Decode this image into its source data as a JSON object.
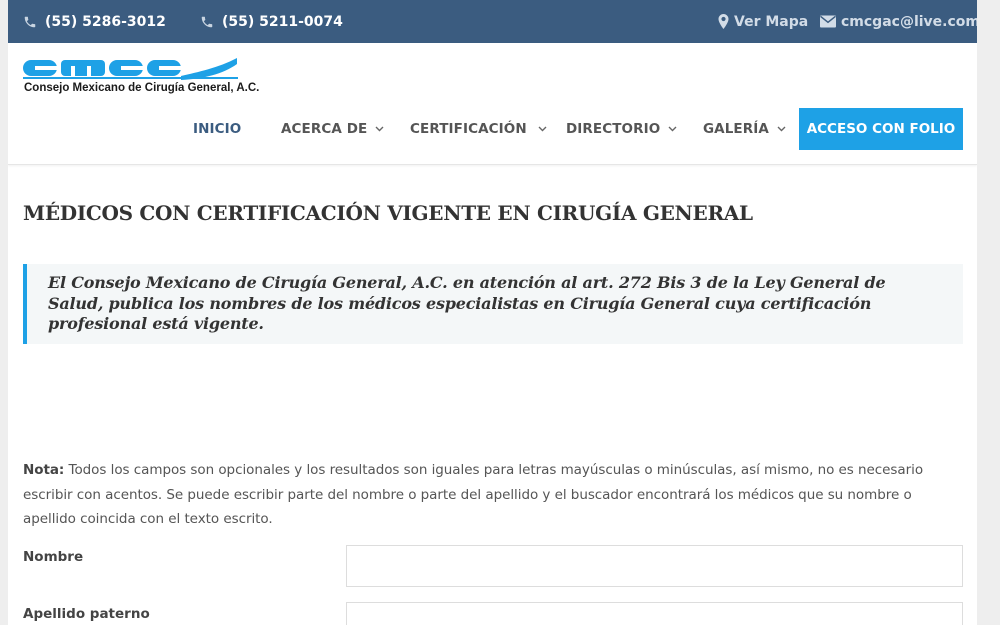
{
  "topbar": {
    "phone1": "(55) 5286-3012",
    "phone2": "(55) 5211-0074",
    "map_label": "Ver Mapa",
    "email": "cmcgac@live.com"
  },
  "header": {
    "logo_letters": "cmcgac",
    "logo_subtitle": "Consejo Mexicano de Cirugía General, A.C."
  },
  "nav": {
    "items": [
      {
        "label": "INICIO",
        "active": true,
        "dropdown": false
      },
      {
        "label": "ACERCA DE",
        "active": false,
        "dropdown": true
      },
      {
        "label": "CERTIFICACIÓN",
        "active": false,
        "dropdown": true
      },
      {
        "label": "DIRECTORIO",
        "active": false,
        "dropdown": true
      },
      {
        "label": "GALERÍA",
        "active": false,
        "dropdown": true
      }
    ],
    "cta_label": "ACCESO CON FOLIO"
  },
  "content": {
    "title": "MÉDICOS CON CERTIFICACIÓN VIGENTE EN CIRUGÍA GENERAL",
    "quote": "El Consejo Mexicano de Cirugía General, A.C. en atención al art. 272 Bis 3 de la Ley General de Salud, publica los nombres de los médicos especialistas en Cirugía General cuya certificación profesional está vigente.",
    "note_label": "Nota:",
    "note_text": "Todos los campos son opcionales y los resultados son iguales para letras mayúsculas o minúsculas, así mismo, no es necesario escribir con acentos. Se puede escribir parte del nombre o parte del apellido y el buscador encontrará los médicos que su nombre o apellido coincida con el texto escrito.",
    "fields": [
      {
        "label": "Nombre",
        "value": "",
        "placeholder": ""
      },
      {
        "label": "Apellido paterno",
        "value": "",
        "placeholder": ""
      }
    ]
  },
  "colors": {
    "topbar_bg": "#3b5c80",
    "accent": "#1ea1e6",
    "logo_blue": "#1ea1e6"
  },
  "icons": {
    "phone": "phone-icon",
    "map": "map-marker-icon",
    "email": "envelope-icon",
    "dropdown": "chevron-down-icon"
  }
}
